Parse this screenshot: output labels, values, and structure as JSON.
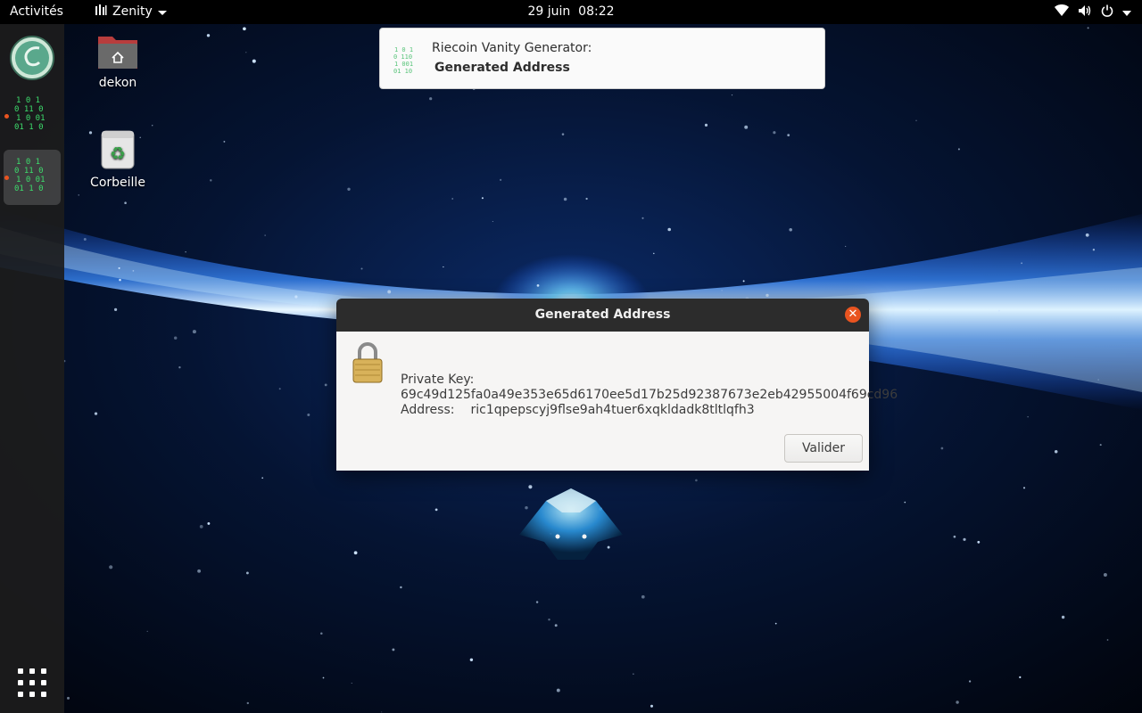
{
  "topbar": {
    "activities": "Activités",
    "app_name": "Zenity",
    "date": "29 juin",
    "time": "08:22",
    "tray_icons": [
      "wifi-icon",
      "volume-icon",
      "power-icon",
      "chevron-down-icon"
    ]
  },
  "dock": {
    "items": [
      {
        "name": "riecoin-app",
        "active": false,
        "running": false
      },
      {
        "name": "terminal-matrix-app",
        "active": false,
        "running": true
      },
      {
        "name": "terminal-matrix-app",
        "active": true,
        "running": true
      }
    ],
    "show_apps_icon": "grid-icon",
    "running_dot_color": "#e95420"
  },
  "desktop": {
    "icons": [
      {
        "label": "dekon",
        "icon": "home-folder-icon"
      },
      {
        "label": "Corbeille",
        "icon": "trash-icon"
      }
    ]
  },
  "notification": {
    "title": "Riecoin Vanity Generator:",
    "body": "Generated Address"
  },
  "dialog": {
    "title": "Generated Address",
    "private_key_label": "Private Key:",
    "private_key": "69c49d125fa0a49e353e65d6170ee5d17b25d92387673e2eb42955004f69cd96",
    "address_label": "Address:",
    "address": "ric1qpepscyj9flse9ah4tuer6xqkldadk8tltlqfh3",
    "ok_label": "Valider",
    "icon": "lock-icon"
  },
  "colors": {
    "accent": "#e95420",
    "topbar": "#000000",
    "dock": "#1c1c1c",
    "dialog_header": "#2c2c2c",
    "dialog_body": "#f6f5f4"
  }
}
